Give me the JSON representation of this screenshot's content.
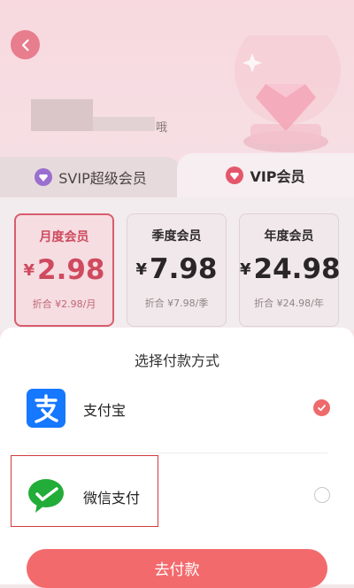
{
  "header": {
    "user_suffix": "哦"
  },
  "tabs": [
    {
      "label": "SVIP超级会员",
      "active": false
    },
    {
      "label": "VIP会员",
      "active": true
    }
  ],
  "plans": [
    {
      "name": "月度会员",
      "currency": "¥",
      "price": "2.98",
      "per": "折合 ¥2.98/月",
      "selected": true
    },
    {
      "name": "季度会员",
      "currency": "¥",
      "price": "7.98",
      "per": "折合 ¥7.98/季",
      "selected": false
    },
    {
      "name": "年度会员",
      "currency": "¥",
      "price": "24.98",
      "per": "折合 ¥24.98/年",
      "selected": false
    }
  ],
  "payment_sheet": {
    "title": "选择付款方式",
    "methods": [
      {
        "label": "支付宝",
        "icon": "alipay-logo",
        "checked": true
      },
      {
        "label": "微信支付",
        "icon": "wechat-pay-logo",
        "checked": false
      }
    ],
    "submit_label": "去付款"
  },
  "colors": {
    "accent": "#f36a6d",
    "plan_selected": "#cf4a5e",
    "alipay_blue": "#1677ff",
    "wechat_green": "#22ac38",
    "annotation_red": "#d43b3b"
  }
}
